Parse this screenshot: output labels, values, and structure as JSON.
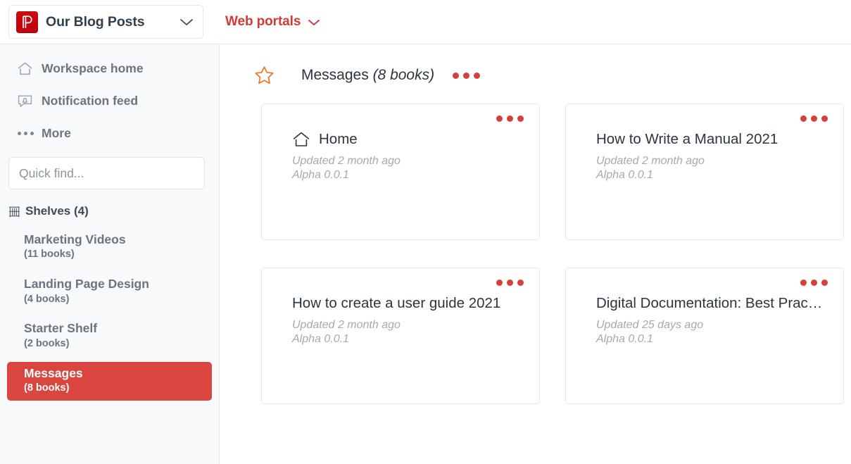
{
  "topbar": {
    "workspace": {
      "logo_icon": "blog-logo-icon",
      "title": "Our Blog Posts",
      "caret_icon": "chevron-down-icon"
    },
    "portal": {
      "label": "Web portals",
      "caret_icon": "chevron-down-icon"
    }
  },
  "sidebar": {
    "nav": [
      {
        "icon": "home-icon",
        "label": "Workspace home"
      },
      {
        "icon": "notification-bell-icon",
        "label": "Notification feed"
      },
      {
        "icon": "ellipsis-icon",
        "label": "More"
      }
    ],
    "search": {
      "placeholder": "Quick find...",
      "value": ""
    },
    "shelves_header": {
      "icon": "bookshelf-icon",
      "label": "Shelves (4)"
    },
    "shelves": [
      {
        "name": "Marketing Videos",
        "count": "(11 books)",
        "active": false
      },
      {
        "name": "Landing Page Design",
        "count": "(4 books)",
        "active": false
      },
      {
        "name": "Starter Shelf",
        "count": "(2 books)",
        "active": false
      },
      {
        "name": "Messages",
        "count": "(8 books)",
        "active": true
      }
    ]
  },
  "main": {
    "star_icon": "star-outline-icon",
    "title": "Messages",
    "title_count": "(8 books)",
    "menu_icon": "ellipsis-icon",
    "cards": [
      {
        "icon": "home-icon",
        "title": "Home",
        "updated": "Updated 2 month ago",
        "version": "Alpha  0.0.1",
        "menu_icon": "ellipsis-icon"
      },
      {
        "icon": "",
        "title": "How to Write a Manual 2021",
        "updated": "Updated 2 month ago",
        "version": "Alpha  0.0.1",
        "menu_icon": "ellipsis-icon"
      },
      {
        "icon": "",
        "title": "How to create a user guide 2021",
        "updated": "Updated 2 month ago",
        "version": "Alpha  0.0.1",
        "menu_icon": "ellipsis-icon"
      },
      {
        "icon": "",
        "title": "Digital Documentation: Best Prac…",
        "updated": "Updated 25 days ago",
        "version": "Alpha  0.0.1",
        "menu_icon": "ellipsis-icon"
      }
    ]
  },
  "colors": {
    "brand_red": "#d9453f",
    "logo_red": "#c9000d",
    "star_orange": "#f4711f",
    "sidebar_bg": "#f7f9fb",
    "border": "#e3e9ee"
  }
}
